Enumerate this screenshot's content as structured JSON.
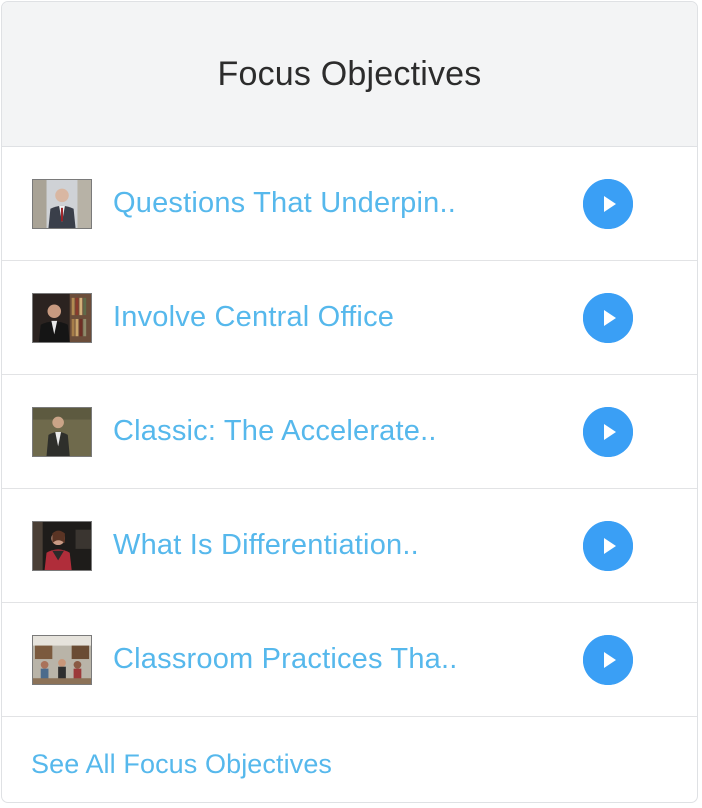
{
  "panel": {
    "title": "Focus Objectives",
    "items": [
      {
        "title": "Questions That Underpin..",
        "thumb": "speaker-portrait-thumbnail",
        "icon": "play-icon"
      },
      {
        "title": "Involve Central Office",
        "thumb": "speaker-bookshelf-thumbnail",
        "icon": "play-icon"
      },
      {
        "title": "Classic: The Accelerate..",
        "thumb": "speaker-standing-thumbnail",
        "icon": "play-icon"
      },
      {
        "title": "What Is Differentiation..",
        "thumb": "speaker-dark-room-thumbnail",
        "icon": "play-icon"
      },
      {
        "title": "Classroom Practices Tha..",
        "thumb": "classroom-thumbnail",
        "icon": "play-icon"
      }
    ],
    "footer_link": "See All Focus Objectives"
  },
  "colors": {
    "link": "#56b8ec",
    "play_button": "#3a9ff5",
    "header_bg": "#f3f4f5",
    "border": "#dfe1e4",
    "title_text": "#2c2c2c"
  }
}
